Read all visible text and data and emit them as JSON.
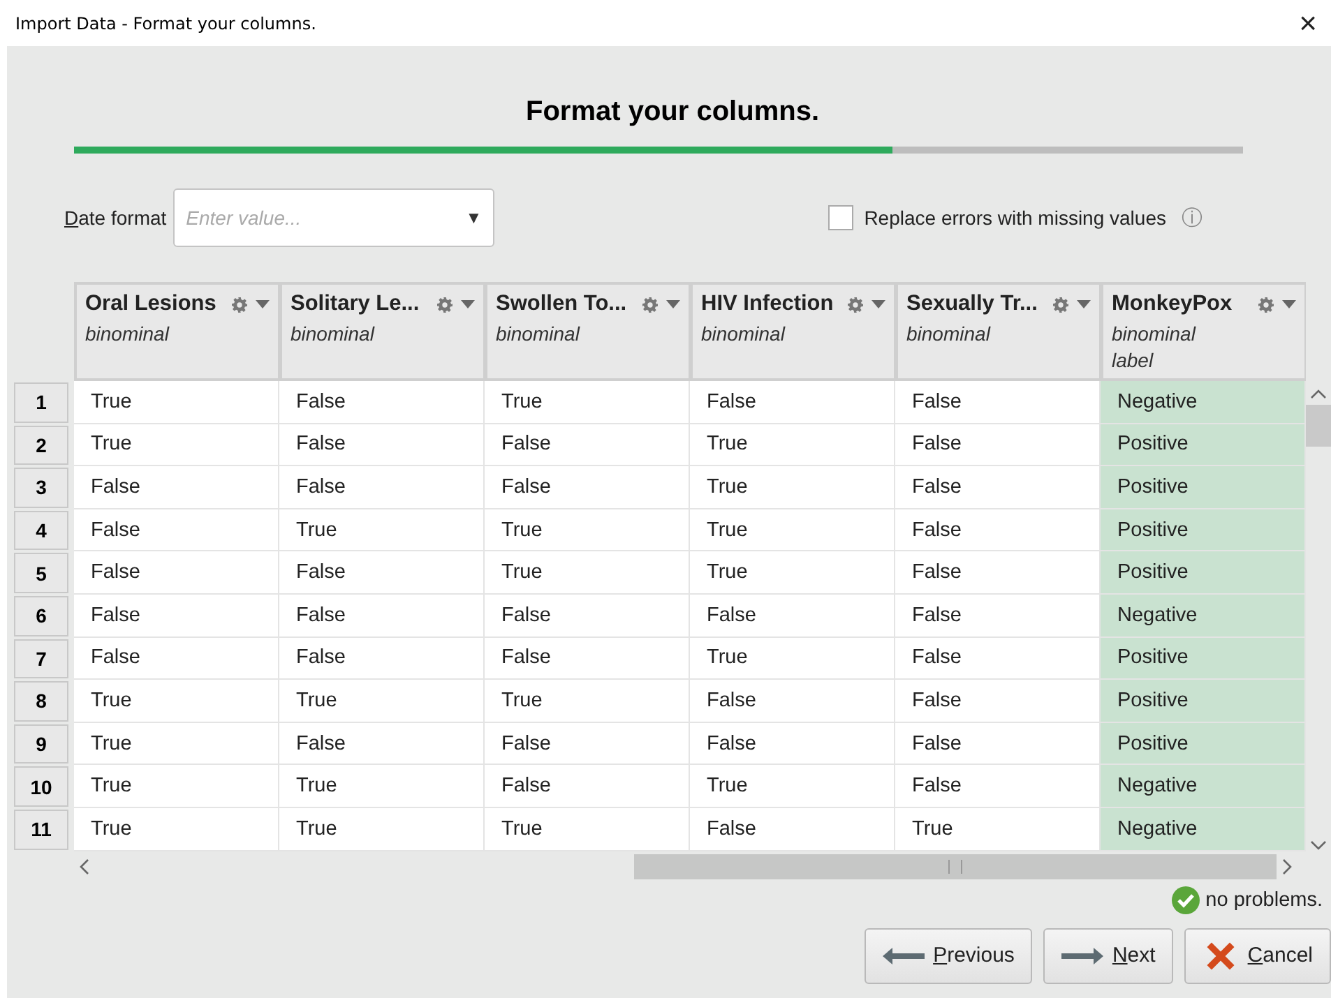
{
  "window": {
    "title": "Import Data - Format your columns.",
    "close": "×"
  },
  "heading": "Format your columns.",
  "progress": {
    "level": 0.7
  },
  "date_format": {
    "label": "Date format",
    "placeholder": "Enter value...",
    "arrow": "▼"
  },
  "replace_errors": {
    "label": "Replace errors with missing values",
    "checked": false,
    "info": "ⓘ"
  },
  "table": {
    "columns": [
      {
        "name": "Oral Lesions",
        "type": "binominal"
      },
      {
        "name": "Solitary Le...",
        "type": "binominal"
      },
      {
        "name": "Swollen To...",
        "type": "binominal"
      },
      {
        "name": "HIV Infection",
        "type": "binominal"
      },
      {
        "name": "Sexually Tr...",
        "type": "binominal"
      },
      {
        "name": "MonkeyPox",
        "type": "binominal",
        "role": "label"
      }
    ],
    "rows": [
      {
        "num": "1",
        "cells": [
          "True",
          "False",
          "True",
          "False",
          "False",
          "Negative"
        ]
      },
      {
        "num": "2",
        "cells": [
          "True",
          "False",
          "False",
          "True",
          "False",
          "Positive"
        ]
      },
      {
        "num": "3",
        "cells": [
          "False",
          "False",
          "False",
          "True",
          "False",
          "Positive"
        ]
      },
      {
        "num": "4",
        "cells": [
          "False",
          "True",
          "True",
          "True",
          "False",
          "Positive"
        ]
      },
      {
        "num": "5",
        "cells": [
          "False",
          "False",
          "True",
          "True",
          "False",
          "Positive"
        ]
      },
      {
        "num": "6",
        "cells": [
          "False",
          "False",
          "False",
          "False",
          "False",
          "Negative"
        ]
      },
      {
        "num": "7",
        "cells": [
          "False",
          "False",
          "False",
          "True",
          "False",
          "Positive"
        ]
      },
      {
        "num": "8",
        "cells": [
          "True",
          "True",
          "True",
          "False",
          "False",
          "Positive"
        ]
      },
      {
        "num": "9",
        "cells": [
          "True",
          "False",
          "False",
          "False",
          "False",
          "Positive"
        ]
      },
      {
        "num": "10",
        "cells": [
          "True",
          "True",
          "False",
          "True",
          "False",
          "Negative"
        ]
      },
      {
        "num": "11",
        "cells": [
          "True",
          "True",
          "True",
          "False",
          "True",
          "Negative"
        ]
      }
    ]
  },
  "status": "no problems.",
  "buttons": [
    {
      "label": "Previous",
      "kind": "previous"
    },
    {
      "label": "Next",
      "kind": "next"
    },
    {
      "label": "Cancel",
      "kind": "cancel"
    }
  ]
}
